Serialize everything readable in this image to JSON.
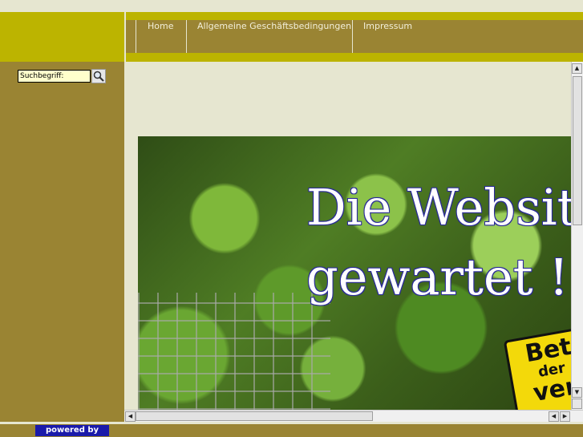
{
  "nav": {
    "items": [
      {
        "label": "Home"
      },
      {
        "label": "Allgemeine Geschäftsbedingungen"
      },
      {
        "label": "Impressum"
      }
    ]
  },
  "search": {
    "value": "Suchbegriff:",
    "button_icon": "magnifier-icon"
  },
  "banner": {
    "line1": "Die Websit",
    "line2": "gewartet !",
    "sign": {
      "line1": "Bet",
      "line2": "der",
      "line3": "ver"
    }
  },
  "footer": {
    "powered_label": "powered by"
  },
  "colors": {
    "olive": "#9a8433",
    "lime": "#bcb400",
    "cream": "#e6e6d0",
    "powered_blue": "#1a1aaa"
  }
}
